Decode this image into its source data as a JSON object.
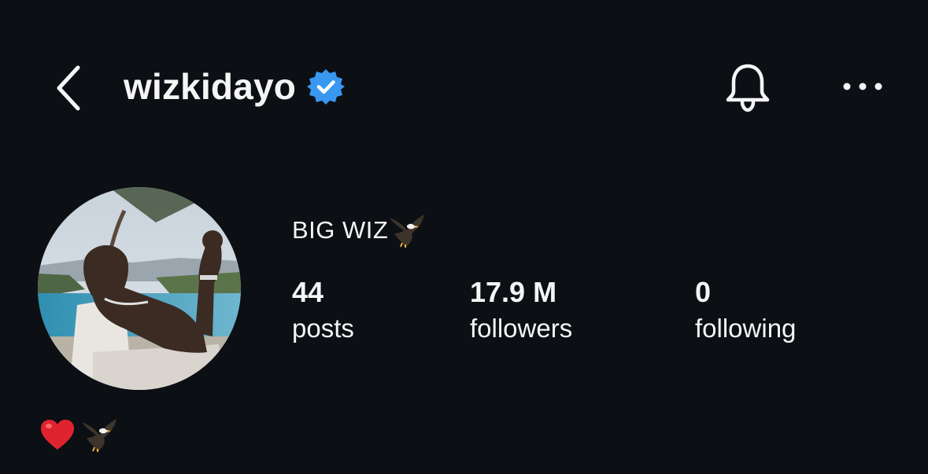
{
  "header": {
    "username": "wizkidayo",
    "back_icon": "chevron-left-icon",
    "verified_icon": "verified-badge-icon",
    "notification_icon": "bell-icon",
    "more_icon": "more-horizontal-icon"
  },
  "profile": {
    "display_name": "BIG WIZ",
    "display_name_emoji": "eagle-emoji-icon",
    "avatar_icon": "profile-photo",
    "stats": {
      "posts": {
        "value": "44",
        "label": "posts"
      },
      "followers": {
        "value": "17.9 M",
        "label": "followers"
      },
      "following": {
        "value": "0",
        "label": "following"
      }
    },
    "bio_emojis": [
      "red-heart-emoji-icon",
      "eagle-emoji-icon"
    ]
  },
  "colors": {
    "background": "#0c0f14",
    "text": "#f5f5f5",
    "verified_blue": "#3897f0"
  }
}
